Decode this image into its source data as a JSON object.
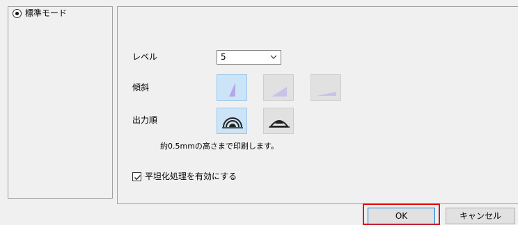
{
  "mode": {
    "label": "標準モード",
    "selected": true
  },
  "settings": {
    "level": {
      "label": "レベル",
      "value": "5"
    },
    "tilt": {
      "label": "傾斜",
      "options": [
        {
          "icon": "steep-slope-icon",
          "selected": true
        },
        {
          "icon": "medium-slope-icon",
          "selected": false
        },
        {
          "icon": "gentle-slope-icon",
          "selected": false
        }
      ]
    },
    "output_order": {
      "label": "出力順",
      "options": [
        {
          "icon": "outer-to-inner-arcs-icon",
          "selected": true
        },
        {
          "icon": "inner-to-outer-dome-icon",
          "selected": false
        }
      ]
    },
    "info_text": "約0.5mmの高さまで印刷します。",
    "flatten": {
      "label": "平坦化処理を有効にする",
      "checked": true
    }
  },
  "buttons": {
    "ok": "OK",
    "cancel": "キャンセル"
  },
  "colors": {
    "selected_tile_bg": "#cce4f7",
    "tile_bg": "#e1e1e1",
    "slope_fill": "#b4a7e8",
    "ok_highlight": "#e00000"
  }
}
